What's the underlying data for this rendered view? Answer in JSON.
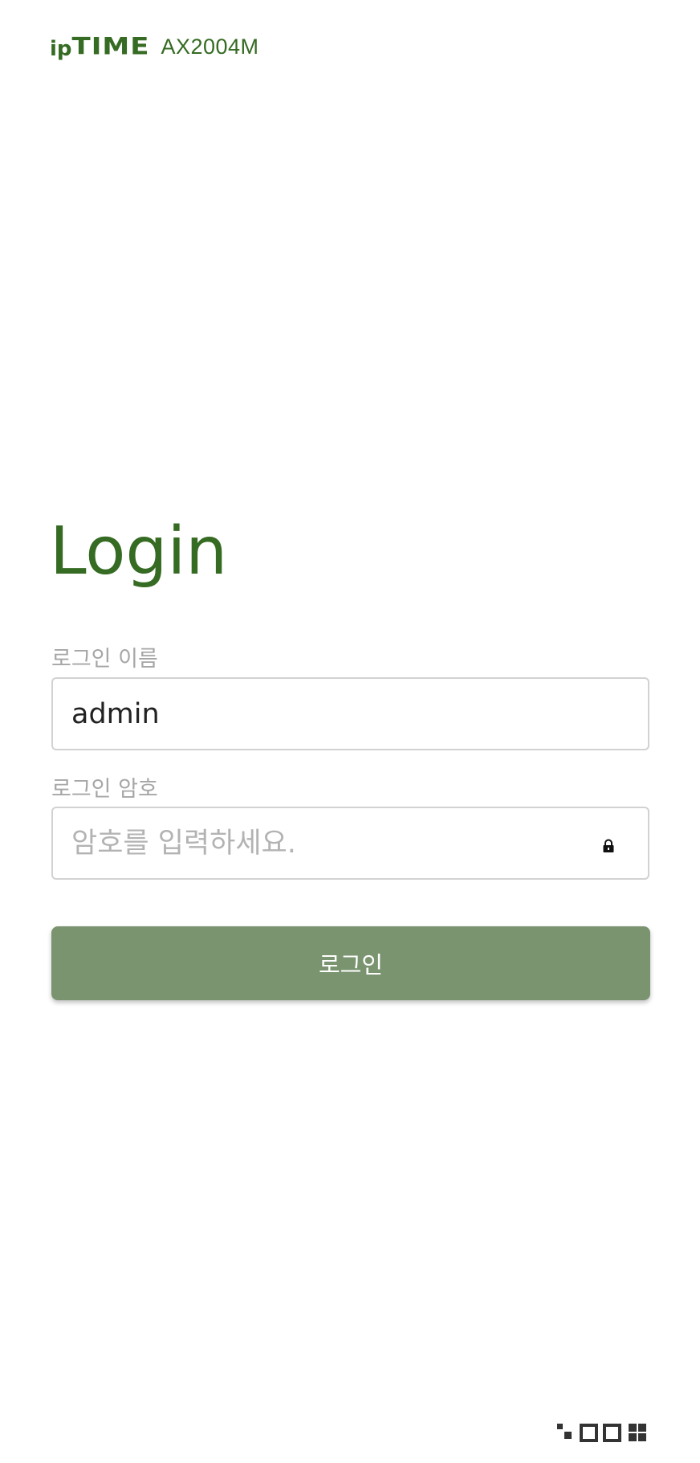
{
  "header": {
    "logo_ip": "ip",
    "logo_time": "TIME",
    "model": "AX2004M"
  },
  "login": {
    "title": "Login",
    "username_label": "로그인 이름",
    "username_value": "admin",
    "password_label": "로그인 암호",
    "password_placeholder": "암호를 입력하세요.",
    "submit_label": "로그인"
  },
  "icons": {
    "lock": "lock-icon",
    "footer": "blocks-logo-icon"
  },
  "colors": {
    "brand_green": "#356b22",
    "button_green": "#7a9470",
    "label_gray": "#a6a6a6"
  }
}
